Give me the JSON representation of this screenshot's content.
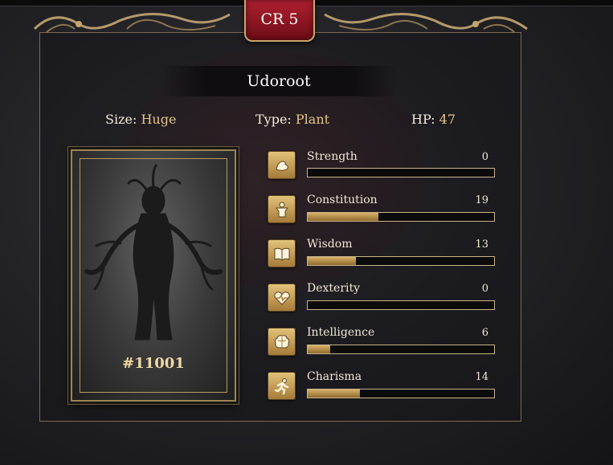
{
  "header": {
    "cr_label": "CR 5"
  },
  "creature": {
    "name": "Udoroot",
    "size_label": "Size:",
    "size_value": "Huge",
    "type_label": "Type:",
    "type_value": "Plant",
    "hp_label": "HP:",
    "hp_value": "47",
    "card_number": "#11001"
  },
  "stats": [
    {
      "label": "Strength",
      "value": "0",
      "fill_fraction": 0.0,
      "icon": "strength-arm-icon"
    },
    {
      "label": "Constitution",
      "value": "19",
      "fill_fraction": 0.38,
      "icon": "constitution-body-icon"
    },
    {
      "label": "Wisdom",
      "value": "13",
      "fill_fraction": 0.26,
      "icon": "wisdom-book-icon"
    },
    {
      "label": "Dexterity",
      "value": "0",
      "fill_fraction": 0.0,
      "icon": "dexterity-heartbeat-icon"
    },
    {
      "label": "Intelligence",
      "value": "6",
      "fill_fraction": 0.12,
      "icon": "intelligence-brain-icon"
    },
    {
      "label": "Charisma",
      "value": "14",
      "fill_fraction": 0.28,
      "icon": "charisma-runner-icon"
    }
  ],
  "colors": {
    "accent_gold": "#e3c68a",
    "badge_red": "#b02030",
    "bar_gold": "#d8b26a"
  }
}
